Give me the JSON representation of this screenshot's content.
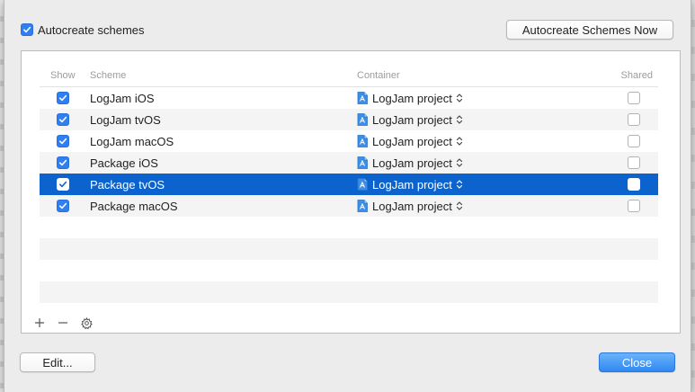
{
  "autocreate": {
    "label": "Autocreate schemes",
    "checked": true
  },
  "autocreate_now_label": "Autocreate Schemes Now",
  "columns": {
    "show": "Show",
    "scheme": "Scheme",
    "container": "Container",
    "shared": "Shared"
  },
  "rows": [
    {
      "show": true,
      "scheme": "LogJam iOS",
      "container": "LogJam project",
      "shared": false,
      "selected": false
    },
    {
      "show": true,
      "scheme": "LogJam tvOS",
      "container": "LogJam project",
      "shared": false,
      "selected": false
    },
    {
      "show": true,
      "scheme": "LogJam macOS",
      "container": "LogJam project",
      "shared": false,
      "selected": false
    },
    {
      "show": true,
      "scheme": "Package iOS",
      "container": "LogJam project",
      "shared": false,
      "selected": false
    },
    {
      "show": true,
      "scheme": "Package tvOS",
      "container": "LogJam project",
      "shared": false,
      "selected": true
    },
    {
      "show": true,
      "scheme": "Package macOS",
      "container": "LogJam project",
      "shared": false,
      "selected": false
    }
  ],
  "toolbar": {
    "add_icon": "plus-icon",
    "remove_icon": "minus-icon",
    "settings_icon": "gear-icon"
  },
  "edit_label": "Edit...",
  "close_label": "Close",
  "colors": {
    "accent": "#2f7ff2",
    "selection": "#0c63ce"
  }
}
